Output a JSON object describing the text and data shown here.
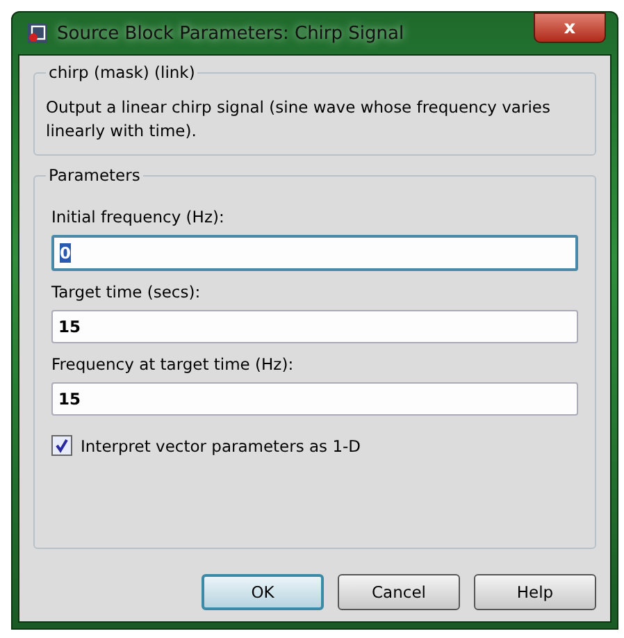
{
  "window": {
    "title": "Source Block Parameters: Chirp Signal",
    "close": "x"
  },
  "description_group": {
    "title": "chirp (mask) (link)",
    "text": "Output a linear chirp signal (sine wave  whose frequency varies linearly with time)."
  },
  "parameters_group": {
    "title": "Parameters",
    "fields": [
      {
        "label": "Initial frequency (Hz):",
        "value": "0",
        "focused": true
      },
      {
        "label": "Target time (secs):",
        "value": "15",
        "focused": false
      },
      {
        "label": "Frequency at target time (Hz):",
        "value": "15",
        "focused": false
      }
    ],
    "checkbox": {
      "label": "Interpret vector parameters as 1-D",
      "checked": true
    }
  },
  "buttons": [
    {
      "label": "OK",
      "default": true
    },
    {
      "label": "Cancel",
      "default": false
    },
    {
      "label": "Help",
      "default": false
    }
  ]
}
